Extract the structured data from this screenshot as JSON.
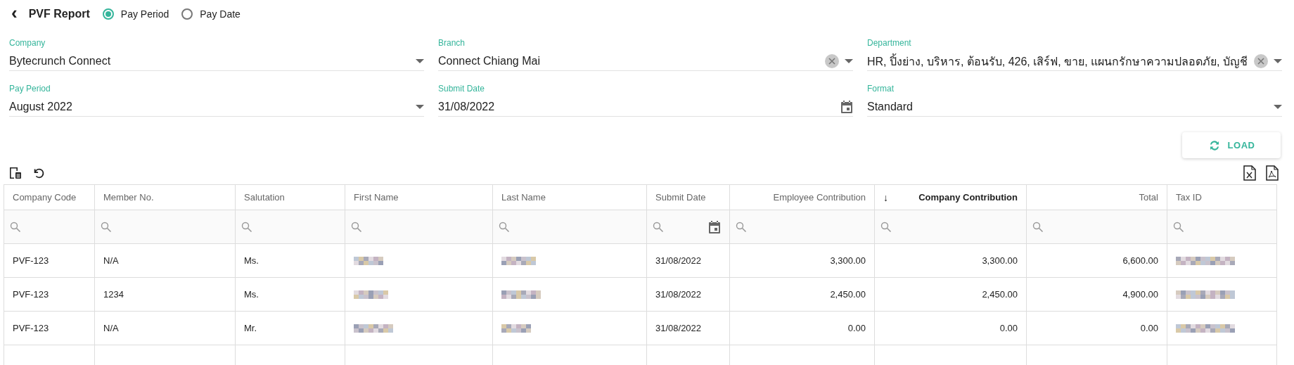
{
  "header": {
    "back": "‹",
    "title": "PVF Report",
    "modes": [
      {
        "label": "Pay Period",
        "selected": true
      },
      {
        "label": "Pay Date",
        "selected": false
      }
    ]
  },
  "filters": [
    {
      "label": "Company",
      "value": "Bytecrunch Connect",
      "kind": "select",
      "clearable": false
    },
    {
      "label": "Branch",
      "value": "Connect Chiang Mai",
      "kind": "select",
      "clearable": true
    },
    {
      "label": "Department",
      "value": "HR, ปิ้งย่าง, บริหาร, ต้อนรับ, 426, เสิร์ฟ, ขาย, แผนกรักษาความปลอดภัย, บัญชี",
      "kind": "select",
      "clearable": true
    },
    {
      "label": "Pay Period",
      "value": "August 2022",
      "kind": "select",
      "clearable": false
    },
    {
      "label": "Submit Date",
      "value": "31/08/2022",
      "kind": "date",
      "clearable": false
    },
    {
      "label": "Format",
      "value": "Standard",
      "kind": "select",
      "clearable": false
    }
  ],
  "load_button": "LOAD",
  "table": {
    "columns": [
      {
        "label": "Company Code",
        "kind": "text",
        "sorted": false
      },
      {
        "label": "Member No.",
        "kind": "text",
        "sorted": false
      },
      {
        "label": "Salutation",
        "kind": "text",
        "sorted": false
      },
      {
        "label": "First Name",
        "kind": "text",
        "sorted": false
      },
      {
        "label": "Last Name",
        "kind": "text",
        "sorted": false
      },
      {
        "label": "Submit Date",
        "kind": "date",
        "sorted": false
      },
      {
        "label": "Employee Contribution",
        "kind": "number",
        "sorted": false
      },
      {
        "label": "Company Contribution",
        "kind": "number",
        "sorted": true,
        "sort_icon": "↓"
      },
      {
        "label": "Total",
        "kind": "number",
        "sorted": false
      },
      {
        "label": "Tax ID",
        "kind": "text",
        "sorted": false
      }
    ],
    "rows": [
      [
        "PVF-123",
        "N/A",
        "Ms.",
        {
          "kind": "redacted"
        },
        {
          "kind": "redacted"
        },
        "31/08/2022",
        "3,300.00",
        "3,300.00",
        "6,600.00",
        {
          "kind": "redacted"
        }
      ],
      [
        "PVF-123",
        "1234",
        "Ms.",
        {
          "kind": "redacted"
        },
        {
          "kind": "redacted"
        },
        "31/08/2022",
        "2,450.00",
        "2,450.00",
        "4,900.00",
        {
          "kind": "redacted"
        }
      ],
      [
        "PVF-123",
        "N/A",
        "Mr.",
        {
          "kind": "redacted"
        },
        {
          "kind": "redacted"
        },
        "31/08/2022",
        "0.00",
        "0.00",
        "0.00",
        {
          "kind": "redacted"
        }
      ]
    ]
  }
}
